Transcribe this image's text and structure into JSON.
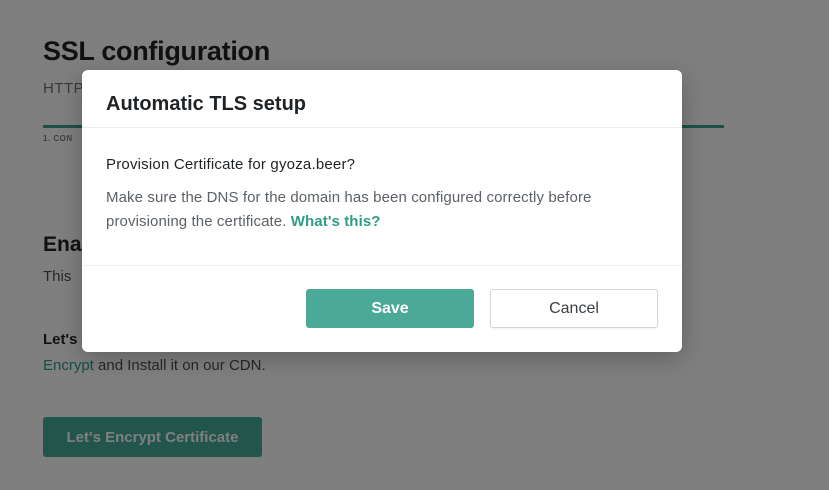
{
  "page": {
    "title": "SSL configuration",
    "subtitle": "HTTP",
    "step_label": "1. CON",
    "section_heading": "Ena",
    "section_desc": "This",
    "le_heading": "Let's",
    "le_link": "Encrypt",
    "le_desc_rest": " and Install it on our CDN.",
    "le_button": "Let's Encrypt Certificate"
  },
  "modal": {
    "title": "Automatic TLS setup",
    "question": "Provision Certificate for gyoza.beer?",
    "text": "Make sure the DNS for the domain has been configured correctly before provisioning the certificate.",
    "link": "What's this?",
    "save_label": "Save",
    "cancel_label": "Cancel"
  },
  "colors": {
    "accent": "#45aa96",
    "link": "#2e9d86",
    "overlay": "rgba(0,0,0,0.5)"
  }
}
